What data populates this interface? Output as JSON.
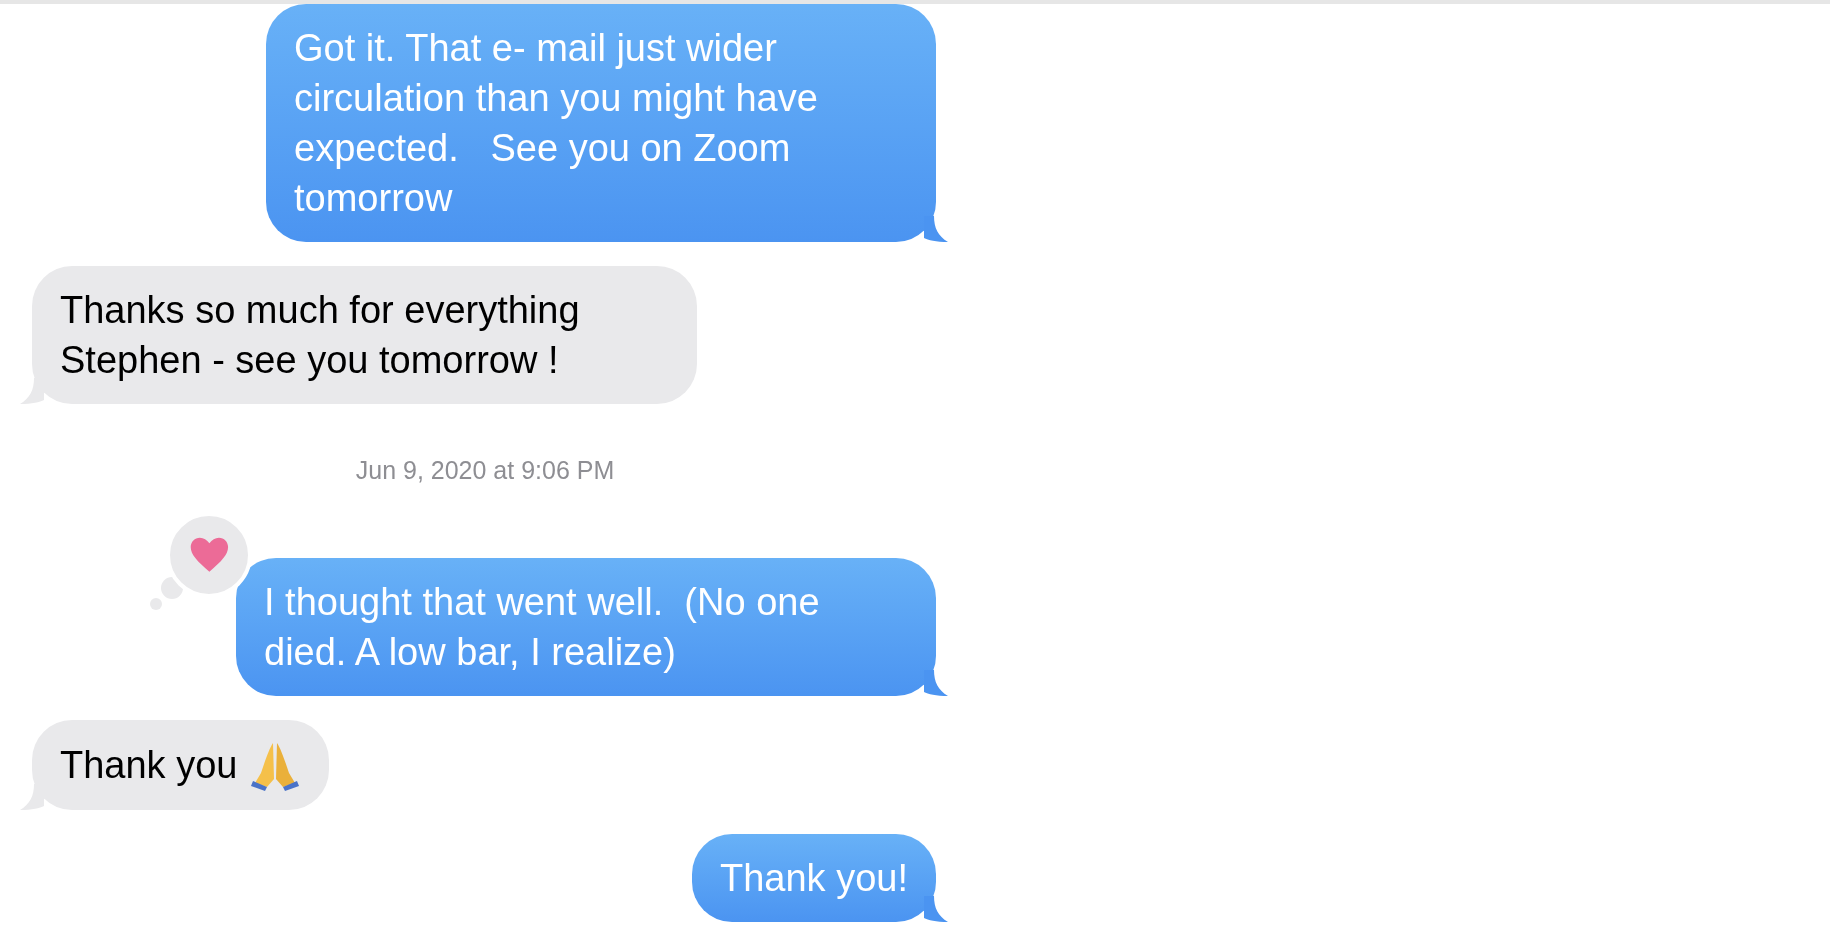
{
  "messages": [
    {
      "kind": "sent",
      "text": "Got it. That e- mail just wider circulation than you might have expected.   See you on Zoom tomorrow",
      "tapback": false
    },
    {
      "kind": "received",
      "text": "Thanks so much for everything Stephen - see you tomorrow !",
      "tapback": false,
      "emoji": false
    },
    {
      "kind": "timestamp",
      "text": "Jun 9, 2020 at 9:06 PM"
    },
    {
      "kind": "sent",
      "text": "I thought that went well.  (No one died. A low bar, I realize)",
      "tapback": true
    },
    {
      "kind": "received",
      "text": "Thank you",
      "tapback": false,
      "emoji": true
    },
    {
      "kind": "sent",
      "text": "Thank you!",
      "tapback": false
    }
  ]
}
